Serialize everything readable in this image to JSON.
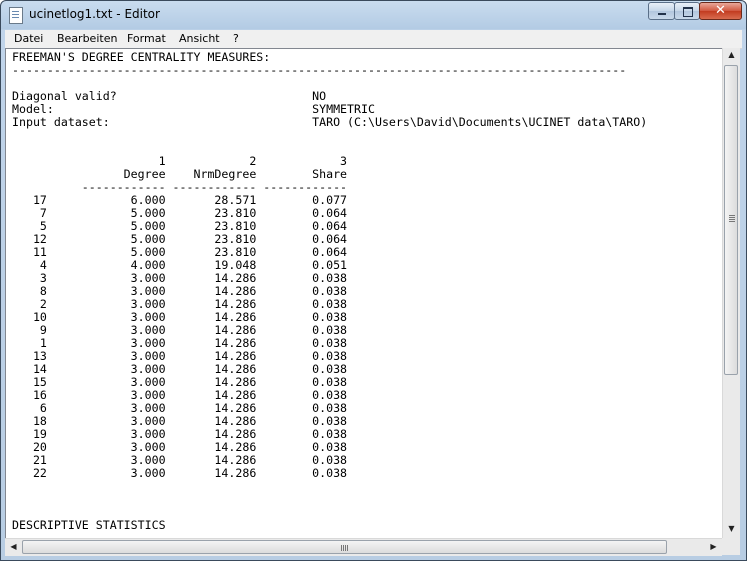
{
  "window": {
    "title": "ucinetlog1.txt - Editor"
  },
  "menu": {
    "items": [
      "Datei",
      "Bearbeiten",
      "Format",
      "Ansicht",
      "?"
    ]
  },
  "document": {
    "lines": [
      "FREEMAN'S DEGREE CENTRALITY MEASURES:",
      "----------------------------------------------------------------------------------------",
      "",
      "Diagonal valid?                            NO",
      "Model:                                     SYMMETRIC",
      "Input dataset:                             TARO (C:\\Users\\David\\Documents\\UCINET data\\TARO)",
      "",
      "",
      "                     1            2            3",
      "                Degree    NrmDegree        Share",
      "          ------------ ------------ ------------",
      "   17            6.000       28.571        0.077",
      "    7            5.000       23.810        0.064",
      "    5            5.000       23.810        0.064",
      "   12            5.000       23.810        0.064",
      "   11            5.000       23.810        0.064",
      "    4            4.000       19.048        0.051",
      "    3            3.000       14.286        0.038",
      "    8            3.000       14.286        0.038",
      "    2            3.000       14.286        0.038",
      "   10            3.000       14.286        0.038",
      "    9            3.000       14.286        0.038",
      "    1            3.000       14.286        0.038",
      "   13            3.000       14.286        0.038",
      "   14            3.000       14.286        0.038",
      "   15            3.000       14.286        0.038",
      "   16            3.000       14.286        0.038",
      "    6            3.000       14.286        0.038",
      "   18            3.000       14.286        0.038",
      "   19            3.000       14.286        0.038",
      "   20            3.000       14.286        0.038",
      "   21            3.000       14.286        0.038",
      "   22            3.000       14.286        0.038",
      "",
      "",
      "",
      "DESCRIPTIVE STATISTICS"
    ]
  }
}
